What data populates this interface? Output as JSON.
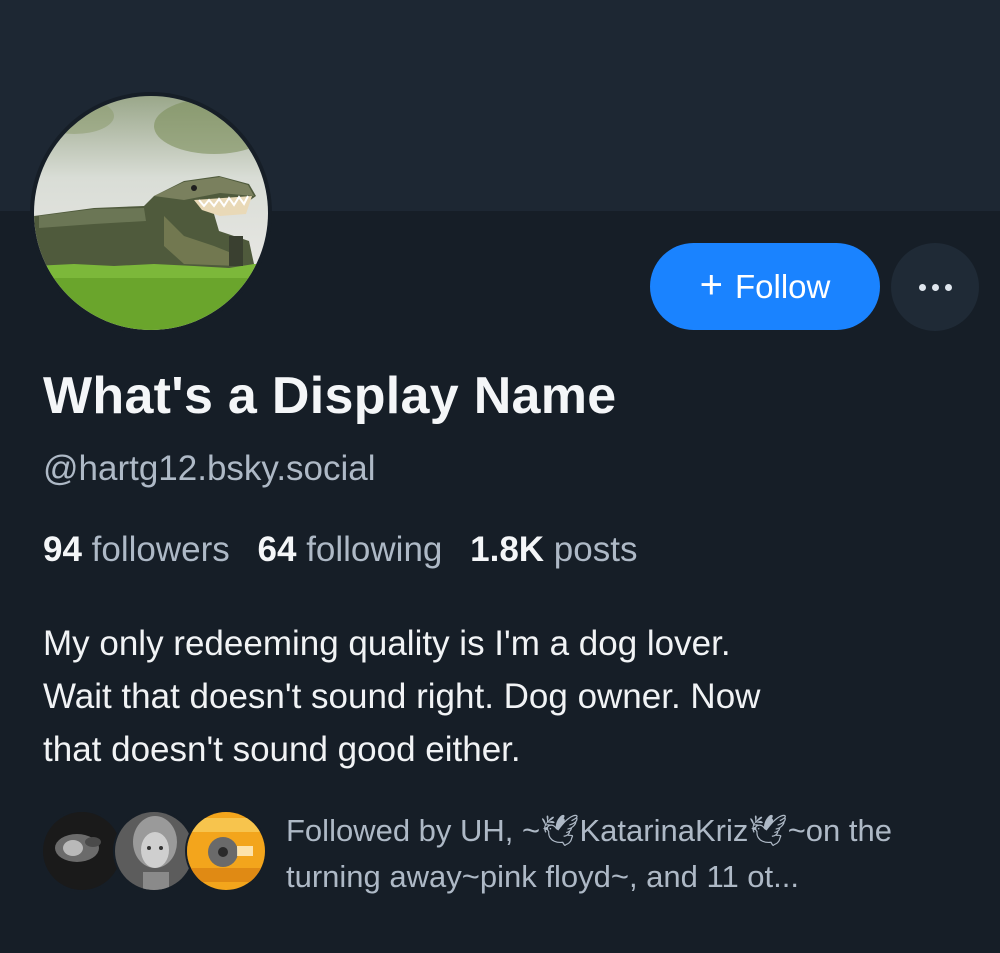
{
  "profile": {
    "display_name": "What's a Display Name",
    "handle": "@hartg12.bsky.social",
    "avatar_icon": "alligator-photo",
    "stats": {
      "followers_count": "94",
      "followers_label": "followers",
      "following_count": "64",
      "following_label": "following",
      "posts_count": "1.8K",
      "posts_label": "posts"
    },
    "bio": "My only redeeming quality is I'm a dog lover.\nWait that doesn't sound right. Dog owner. Now\nthat doesn't sound good either."
  },
  "actions": {
    "follow_label": "Follow",
    "follow_icon": "plus-icon",
    "more_icon": "ellipsis-icon"
  },
  "followed_by": {
    "text": "Followed by UH, ~🕊KatarinaKriz🕊~on the turning away~pink floyd~, and 11 ot...",
    "avatars": [
      "dark-photo-avatar",
      "person-photo-avatar",
      "record-label-avatar"
    ]
  },
  "colors": {
    "background": "#161e27",
    "banner": "#1d2733",
    "accent": "#1a83ff",
    "secondary_text": "#aeb9c6"
  }
}
